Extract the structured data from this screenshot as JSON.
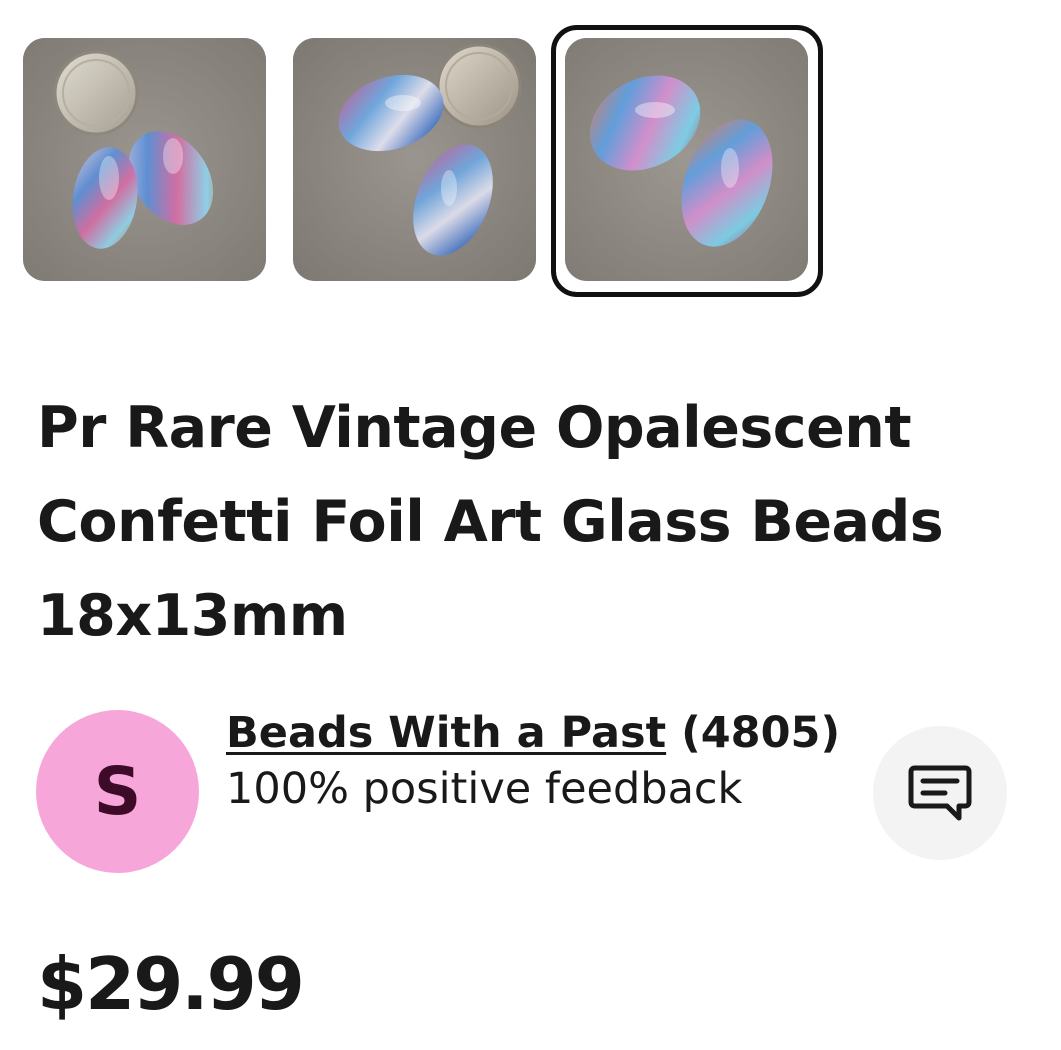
{
  "gallery": {
    "thumbnails": [
      {
        "icon": "bead-photo-with-dime",
        "selected": false
      },
      {
        "icon": "bead-photo-with-dime",
        "selected": false
      },
      {
        "icon": "bead-photo-closeup",
        "selected": true
      }
    ]
  },
  "listing": {
    "title": "Pr Rare Vintage Opalescent Confetti Foil Art Glass Beads 18x13mm",
    "price": "$29.99"
  },
  "seller": {
    "avatar_initial": "S",
    "avatar_color": "#f7a6d9",
    "name": "Beads With a Past",
    "feedback_count": "(4805)",
    "feedback_text": "100% positive feedback",
    "message_icon": "message-icon"
  }
}
